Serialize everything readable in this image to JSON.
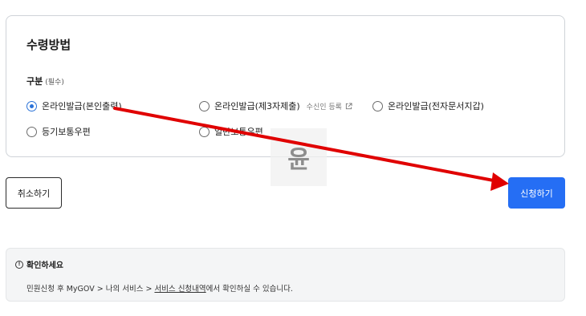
{
  "card": {
    "title": "수령방법",
    "field_label": "구분",
    "field_required": "(필수)",
    "options": [
      {
        "label": "온라인발급(본인출력)",
        "checked": true
      },
      {
        "label": "온라인발급(제3자제출)",
        "checked": false,
        "extra": "수신인 등록"
      },
      {
        "label": "온라인발급(전자문서지갑)",
        "checked": false
      },
      {
        "label": "등기보통우편",
        "checked": false
      },
      {
        "label": "일반보통우편",
        "checked": false
      }
    ]
  },
  "buttons": {
    "cancel": "취소하기",
    "submit": "신청하기"
  },
  "notice": {
    "title": "확인하세요",
    "text_prefix": "민원신청 후 MyGOV > 나의 서비스 > ",
    "text_link": "서비스 신청내역",
    "text_suffix": "에서 확인하실 수 있습니다."
  },
  "watermark": {
    "text": "윤"
  },
  "colors": {
    "accent": "#256ef4",
    "radio_checked": "#2a72d8",
    "annotation_arrow": "#e00000"
  }
}
